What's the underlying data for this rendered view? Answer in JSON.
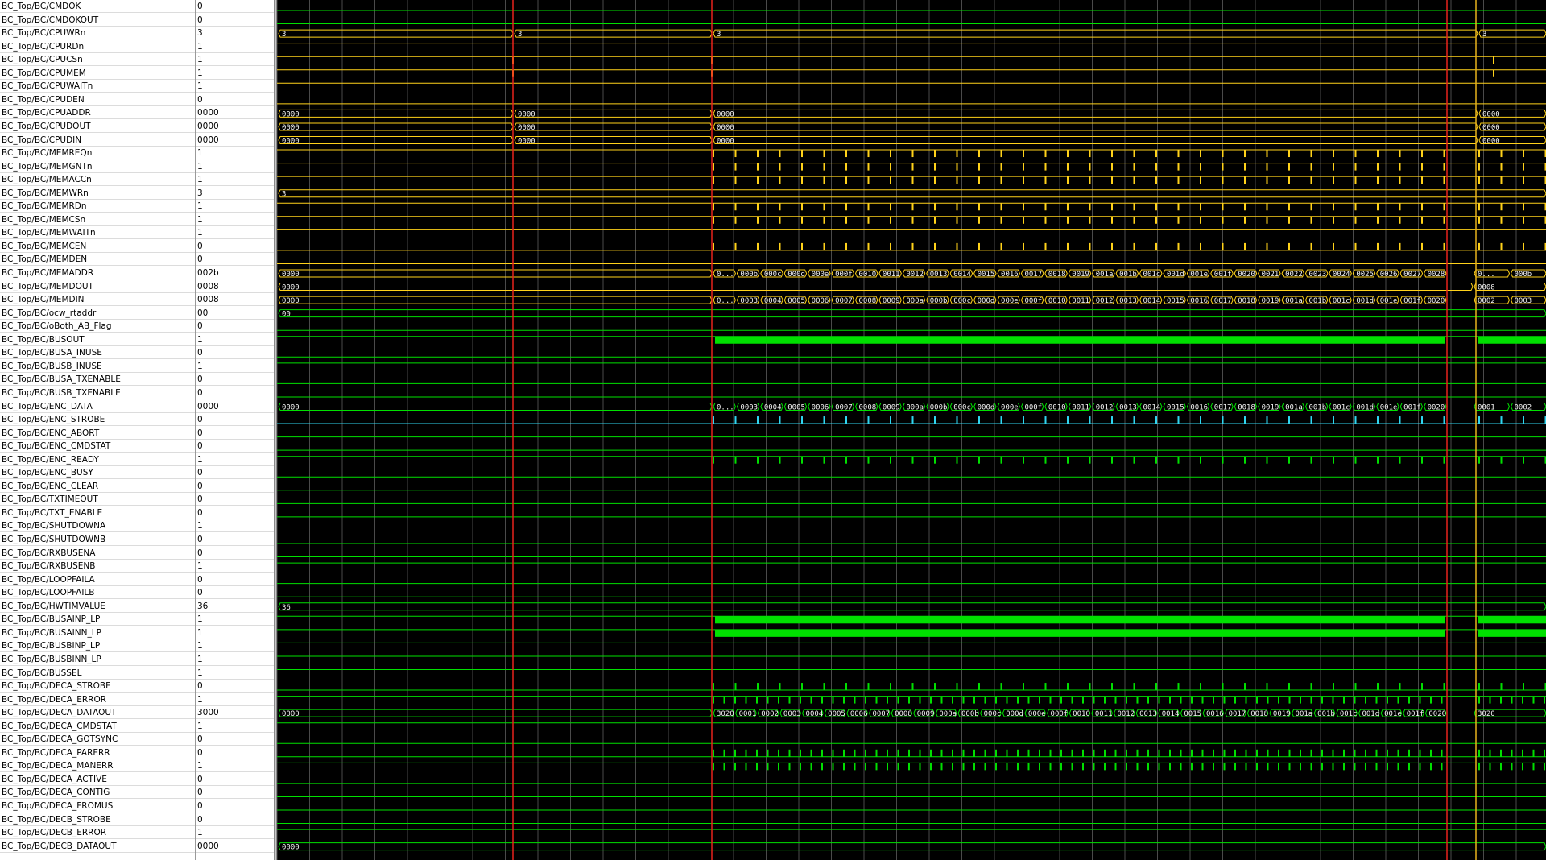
{
  "colors": {
    "wave_bg": "#000000",
    "grid": "#4a4a4a",
    "signal_green": "#00e000",
    "signal_yellow": "#ffd21a",
    "signal_cyan": "#31d6f0",
    "cursor_red": "#e8221c",
    "cursor_yellow": "#e8b21c"
  },
  "signals": [
    {
      "name": "BC_Top/BC/CMDOK",
      "value": "0",
      "kind": "bit",
      "color": "green"
    },
    {
      "name": "BC_Top/BC/CMDOKOUT",
      "value": "0",
      "kind": "bit",
      "color": "green"
    },
    {
      "name": "BC_Top/BC/CPUWRn",
      "value": "3",
      "kind": "bus",
      "color": "yellow",
      "labels": [
        "3",
        "3",
        "3",
        "3"
      ]
    },
    {
      "name": "BC_Top/BC/CPURDn",
      "value": "1",
      "kind": "bit",
      "color": "yellow"
    },
    {
      "name": "BC_Top/BC/CPUCSn",
      "value": "1",
      "kind": "bit",
      "color": "yellow"
    },
    {
      "name": "BC_Top/BC/CPUMEM",
      "value": "1",
      "kind": "bit",
      "color": "yellow"
    },
    {
      "name": "BC_Top/BC/CPUWAITn",
      "value": "1",
      "kind": "bit",
      "color": "yellow"
    },
    {
      "name": "BC_Top/BC/CPUDEN",
      "value": "0",
      "kind": "bit",
      "color": "yellow"
    },
    {
      "name": "BC_Top/BC/CPUADDR",
      "value": "0000",
      "kind": "bus",
      "color": "yellow",
      "labels": [
        "0000",
        "0000",
        "0000",
        "0000"
      ]
    },
    {
      "name": "BC_Top/BC/CPUDOUT",
      "value": "0000",
      "kind": "bus",
      "color": "yellow",
      "labels": [
        "0000",
        "0000",
        "0000",
        "0000"
      ]
    },
    {
      "name": "BC_Top/BC/CPUDIN",
      "value": "0000",
      "kind": "bus",
      "color": "yellow",
      "labels": [
        "0000",
        "0000",
        "0000",
        "0000"
      ]
    },
    {
      "name": "BC_Top/BC/MEMREQn",
      "value": "1",
      "kind": "bit",
      "color": "yellow"
    },
    {
      "name": "BC_Top/BC/MEMGNTn",
      "value": "1",
      "kind": "bit",
      "color": "yellow"
    },
    {
      "name": "BC_Top/BC/MEMACCn",
      "value": "1",
      "kind": "bit",
      "color": "yellow"
    },
    {
      "name": "BC_Top/BC/MEMWRn",
      "value": "3",
      "kind": "bus",
      "color": "yellow",
      "labels": [
        "3"
      ]
    },
    {
      "name": "BC_Top/BC/MEMRDn",
      "value": "1",
      "kind": "bit",
      "color": "yellow"
    },
    {
      "name": "BC_Top/BC/MEMCSn",
      "value": "1",
      "kind": "bit",
      "color": "yellow"
    },
    {
      "name": "BC_Top/BC/MEMWAITn",
      "value": "1",
      "kind": "bit",
      "color": "yellow"
    },
    {
      "name": "BC_Top/BC/MEMCEN",
      "value": "0",
      "kind": "bit",
      "color": "yellow"
    },
    {
      "name": "BC_Top/BC/MEMDEN",
      "value": "0",
      "kind": "bit",
      "color": "yellow"
    },
    {
      "name": "BC_Top/BC/MEMADDR",
      "value": "002b",
      "kind": "bus",
      "color": "yellow",
      "labels": [
        "0000",
        "0...",
        "000b",
        "000c",
        "000d",
        "000e",
        "000f",
        "0010",
        "0011",
        "0012",
        "0013",
        "0014",
        "0015",
        "0016",
        "0017",
        "0018",
        "0019",
        "001a",
        "001b",
        "001c",
        "001d",
        "001e",
        "001f",
        "0020",
        "0021",
        "0022",
        "0023",
        "0024",
        "0025",
        "0026",
        "0027",
        "0028",
        "0...",
        "000b"
      ]
    },
    {
      "name": "BC_Top/BC/MEMDOUT",
      "value": "0008",
      "kind": "bus",
      "color": "yellow",
      "labels": [
        "0000",
        "0008"
      ]
    },
    {
      "name": "BC_Top/BC/MEMDIN",
      "value": "0008",
      "kind": "bus",
      "color": "yellow",
      "labels": [
        "0000",
        "0...",
        "0003",
        "0004",
        "0005",
        "0006",
        "0007",
        "0008",
        "0009",
        "000a",
        "000b",
        "000c",
        "000d",
        "000e",
        "000f",
        "0010",
        "0011",
        "0012",
        "0013",
        "0014",
        "0015",
        "0016",
        "0017",
        "0018",
        "0019",
        "001a",
        "001b",
        "001c",
        "001d",
        "001e",
        "001f",
        "0020",
        "0002",
        "0003"
      ]
    },
    {
      "name": "BC_Top/BC/ocw_rtaddr",
      "value": "00",
      "kind": "bus",
      "color": "green",
      "labels": [
        "00"
      ]
    },
    {
      "name": "BC_Top/BC/oBoth_AB_Flag",
      "value": "0",
      "kind": "bit",
      "color": "green"
    },
    {
      "name": "BC_Top/BC/BUSOUT",
      "value": "1",
      "kind": "bit",
      "color": "green"
    },
    {
      "name": "BC_Top/BC/BUSA_INUSE",
      "value": "0",
      "kind": "bit",
      "color": "green"
    },
    {
      "name": "BC_Top/BC/BUSB_INUSE",
      "value": "1",
      "kind": "bit",
      "color": "green"
    },
    {
      "name": "BC_Top/BC/BUSA_TXENABLE",
      "value": "0",
      "kind": "bit",
      "color": "green"
    },
    {
      "name": "BC_Top/BC/BUSB_TXENABLE",
      "value": "0",
      "kind": "bit",
      "color": "green"
    },
    {
      "name": "BC_Top/BC/ENC_DATA",
      "value": "0000",
      "kind": "bus",
      "color": "green",
      "labels": [
        "0000",
        "0...",
        "0003",
        "0004",
        "0005",
        "0006",
        "0007",
        "0008",
        "0009",
        "000a",
        "000b",
        "000c",
        "000d",
        "000e",
        "000f",
        "0010",
        "0011",
        "0012",
        "0013",
        "0014",
        "0015",
        "0016",
        "0017",
        "0018",
        "0019",
        "001a",
        "001b",
        "001c",
        "001d",
        "001e",
        "001f",
        "0020",
        "0001",
        "0002"
      ]
    },
    {
      "name": "BC_Top/BC/ENC_STROBE",
      "value": "0",
      "kind": "bit",
      "color": "cyan"
    },
    {
      "name": "BC_Top/BC/ENC_ABORT",
      "value": "0",
      "kind": "bit",
      "color": "green"
    },
    {
      "name": "BC_Top/BC/ENC_CMDSTAT",
      "value": "0",
      "kind": "bit",
      "color": "green"
    },
    {
      "name": "BC_Top/BC/ENC_READY",
      "value": "1",
      "kind": "bit",
      "color": "green"
    },
    {
      "name": "BC_Top/BC/ENC_BUSY",
      "value": "0",
      "kind": "bit",
      "color": "green"
    },
    {
      "name": "BC_Top/BC/ENC_CLEAR",
      "value": "0",
      "kind": "bit",
      "color": "green"
    },
    {
      "name": "BC_Top/BC/TXTIMEOUT",
      "value": "0",
      "kind": "bit",
      "color": "green"
    },
    {
      "name": "BC_Top/BC/TXT_ENABLE",
      "value": "0",
      "kind": "bit",
      "color": "green"
    },
    {
      "name": "BC_Top/BC/SHUTDOWNA",
      "value": "1",
      "kind": "bit",
      "color": "green"
    },
    {
      "name": "BC_Top/BC/SHUTDOWNB",
      "value": "0",
      "kind": "bit",
      "color": "green"
    },
    {
      "name": "BC_Top/BC/RXBUSENA",
      "value": "0",
      "kind": "bit",
      "color": "green"
    },
    {
      "name": "BC_Top/BC/RXBUSENB",
      "value": "1",
      "kind": "bit",
      "color": "green"
    },
    {
      "name": "BC_Top/BC/LOOPFAILA",
      "value": "0",
      "kind": "bit",
      "color": "green"
    },
    {
      "name": "BC_Top/BC/LOOPFAILB",
      "value": "0",
      "kind": "bit",
      "color": "green"
    },
    {
      "name": "BC_Top/BC/HWTIMVALUE",
      "value": "36",
      "kind": "bus",
      "color": "green",
      "labels": [
        "36"
      ]
    },
    {
      "name": "BC_Top/BC/BUSAINP_LP",
      "value": "1",
      "kind": "bit",
      "color": "green"
    },
    {
      "name": "BC_Top/BC/BUSAINN_LP",
      "value": "1",
      "kind": "bit",
      "color": "green"
    },
    {
      "name": "BC_Top/BC/BUSBINP_LP",
      "value": "1",
      "kind": "bit",
      "color": "green"
    },
    {
      "name": "BC_Top/BC/BUSBINN_LP",
      "value": "1",
      "kind": "bit",
      "color": "green"
    },
    {
      "name": "BC_Top/BC/BUSSEL",
      "value": "1",
      "kind": "bit",
      "color": "green"
    },
    {
      "name": "BC_Top/BC/DECA_STROBE",
      "value": "0",
      "kind": "bit",
      "color": "green"
    },
    {
      "name": "BC_Top/BC/DECA_ERROR",
      "value": "1",
      "kind": "bit",
      "color": "green"
    },
    {
      "name": "BC_Top/BC/DECA_DATAOUT",
      "value": "3000",
      "kind": "bus",
      "color": "green",
      "labels": [
        "0000",
        "3020",
        "0001",
        "0002",
        "0003",
        "0004",
        "0005",
        "0006",
        "0007",
        "0008",
        "0009",
        "000a",
        "000b",
        "000c",
        "000d",
        "000e",
        "000f",
        "0010",
        "0011",
        "0012",
        "0013",
        "0014",
        "0015",
        "0016",
        "0017",
        "0018",
        "0019",
        "001a",
        "001b",
        "001c",
        "001d",
        "001e",
        "001f",
        "0020",
        "3020"
      ]
    },
    {
      "name": "BC_Top/BC/DECA_CMDSTAT",
      "value": "1",
      "kind": "bit",
      "color": "green"
    },
    {
      "name": "BC_Top/BC/DECA_GOTSYNC",
      "value": "0",
      "kind": "bit",
      "color": "green"
    },
    {
      "name": "BC_Top/BC/DECA_PARERR",
      "value": "0",
      "kind": "bit",
      "color": "green"
    },
    {
      "name": "BC_Top/BC/DECA_MANERR",
      "value": "1",
      "kind": "bit",
      "color": "green"
    },
    {
      "name": "BC_Top/BC/DECA_ACTIVE",
      "value": "0",
      "kind": "bit",
      "color": "green"
    },
    {
      "name": "BC_Top/BC/DECA_CONTIG",
      "value": "0",
      "kind": "bit",
      "color": "green"
    },
    {
      "name": "BC_Top/BC/DECA_FROMUS",
      "value": "0",
      "kind": "bit",
      "color": "green"
    },
    {
      "name": "BC_Top/BC/DECB_STROBE",
      "value": "0",
      "kind": "bit",
      "color": "green"
    },
    {
      "name": "BC_Top/BC/DECB_ERROR",
      "value": "1",
      "kind": "bit",
      "color": "green"
    },
    {
      "name": "BC_Top/BC/DECB_DATAOUT",
      "value": "0000",
      "kind": "bus",
      "color": "green",
      "labels": [
        "0000"
      ]
    }
  ],
  "cursors": [
    {
      "name": "cursor-1",
      "color": "cursor_red"
    },
    {
      "name": "cursor-2",
      "color": "cursor_red"
    },
    {
      "name": "cursor-3",
      "color": "cursor_red"
    },
    {
      "name": "cursor-4",
      "color": "cursor_yellow"
    }
  ]
}
